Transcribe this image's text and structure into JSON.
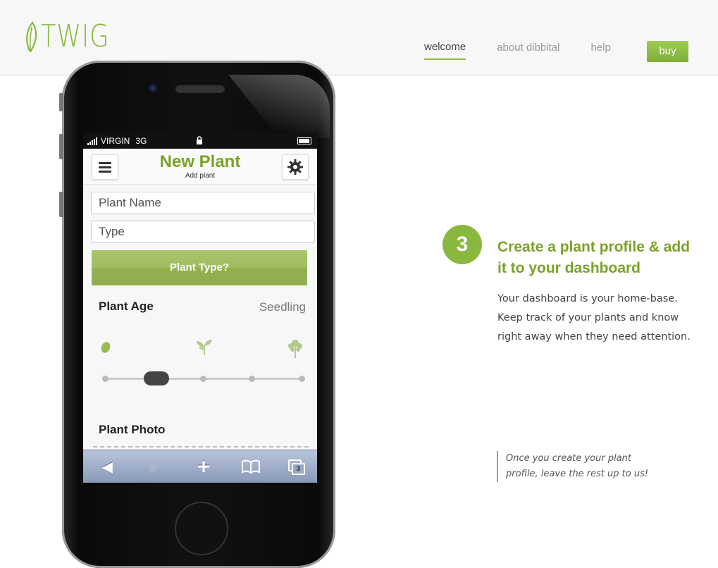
{
  "brand": {
    "logo_text": "TWIG",
    "accent_color": "#8ab83f"
  },
  "nav": {
    "items": [
      {
        "label": "welcome",
        "active": true
      },
      {
        "label": "about dibbital",
        "active": false
      },
      {
        "label": "help",
        "active": false
      }
    ],
    "buy_label": "buy"
  },
  "phone": {
    "status_bar": {
      "carrier": "VIRGIN",
      "network": "3G"
    },
    "app": {
      "title": "New Plant",
      "subtitle": "Add plant",
      "plant_name_placeholder": "Plant Name",
      "type_placeholder": "Type",
      "plant_type_button": "Plant Type?",
      "plant_age_label": "Plant Age",
      "plant_age_value": "Seedling",
      "plant_photo_label": "Plant Photo"
    },
    "toolbar": {
      "tabs_count": "3",
      "icons": [
        "back-arrow-icon",
        "forward-arrow-icon",
        "add-icon",
        "bookmarks-icon",
        "tabs-icon"
      ]
    }
  },
  "step": {
    "number": "3",
    "title": "Create a plant profile & add it to your dashboard",
    "body": "Your dashboard is your home-base. Keep track of your plants and know right away when they need attention.",
    "note": "Once you create your plant profile, leave the rest up to us!"
  }
}
